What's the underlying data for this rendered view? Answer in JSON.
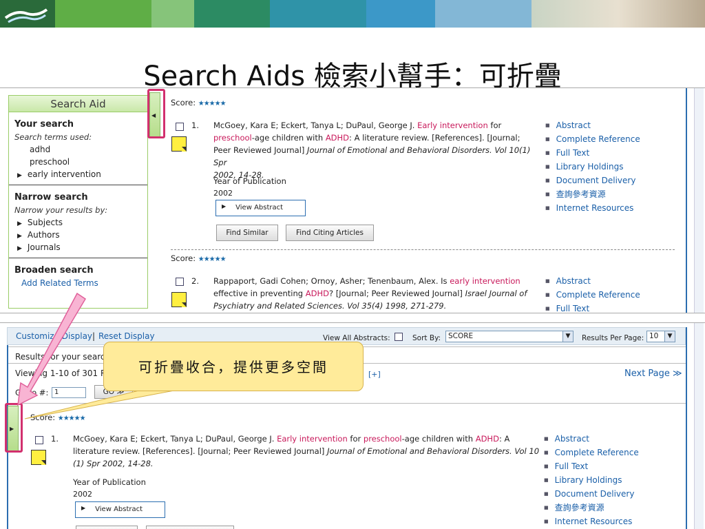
{
  "slide": {
    "title": "Search Aids 檢索小幫手：可折疊",
    "callout": "可折疊收合，提供更多空間"
  },
  "search_aid": {
    "title": "Search Aid",
    "your_search": "Your search",
    "terms_used": "Search terms used:",
    "terms": [
      "adhd",
      "preschool",
      "early intervention"
    ],
    "narrow": "Narrow search",
    "narrow_by": "Narrow your results by:",
    "facets": [
      "Subjects",
      "Authors",
      "Journals"
    ],
    "broaden": "Broaden search",
    "add_related": "Add Related Terms"
  },
  "results_top": {
    "score_label": "Score:",
    "stars": "★★★★★",
    "r1": {
      "num": "1.",
      "authors": "McGoey, Kara E; Eckert, Tanya L; DuPaul, George J.",
      "kw1": "Early intervention",
      "t1": "for",
      "kw2": "preschool",
      "t2": "-age children with",
      "kw3": "ADHD",
      "t3": ": A literature review. [References]. [Journal;",
      "t4": "Peer Reviewed Journal]",
      "journal": "Journal of Emotional and Behavioral Disorders. Vol 10(1) Spr",
      "journal2": "2002, 14-28.",
      "year_label": "Year of Publication",
      "year": "2002",
      "view_abstract": "View Abstract",
      "find_similar": "Find Similar",
      "find_citing": "Find Citing Articles"
    },
    "r2": {
      "num": "2.",
      "authors": "Rappaport, Gadi Cohen; Ornoy, Asher; Tenenbaum, Alex. Is",
      "kw1": "early intervention",
      "t1": "effective in preventing",
      "kw2": "ADHD",
      "t2": "? [Journal; Peer Reviewed Journal]",
      "journal": "Israel Journal of",
      "journal2": "Psychiatry and Related Sciences. Vol 35(4) 1998, 271-279."
    },
    "links1": [
      "Abstract",
      "Complete Reference",
      "Full Text",
      "Library Holdings",
      "Document Delivery",
      "查詢參考資源",
      "Internet Resources"
    ],
    "links2": [
      "Abstract",
      "Complete Reference",
      "Full Text"
    ]
  },
  "results_bottom": {
    "customize": "Customize Display",
    "sep": "|",
    "reset": "Reset Display",
    "view_all": "View All Abstracts:",
    "sort_by": "Sort By:",
    "sort_value": "SCORE",
    "per_page": "Results Per Page:",
    "per_page_value": "10",
    "results_for": "Results for your search:",
    "viewing": "Viewing 1-10 of 301 Re",
    "expand": "[+]",
    "next_page": "Next Page ≫",
    "goto": "Go to #:",
    "goto_value": "1",
    "go": "GO ≫",
    "score_label": "Score:",
    "stars": "★★★★★",
    "r1": {
      "num": "1.",
      "authors": "McGoey, Kara E; Eckert, Tanya L; DuPaul, George J.",
      "kw1": "Early intervention",
      "t1": "for",
      "kw2": "preschool",
      "t2": "-age children with",
      "kw3": "ADHD",
      "t3": ": A",
      "line2": "literature review. [References]. [Journal; Peer Reviewed Journal]",
      "journal": "Journal of Emotional and Behavioral Disorders. Vol 10",
      "journal2": "(1) Spr 2002, 14-28.",
      "year_label": "Year of Publication",
      "year": "2002",
      "view_abstract": "View Abstract"
    },
    "links": [
      "Abstract",
      "Complete Reference",
      "Full Text",
      "Library Holdings",
      "Document Delivery",
      "查詢參考資源",
      "Internet Resources"
    ]
  },
  "colors": {
    "highlight": "#d2306e",
    "keyword": "#c8185a",
    "link": "#1a5fa8",
    "callout_bg": "#ffeb9a",
    "arrow": "#f59ac4"
  }
}
